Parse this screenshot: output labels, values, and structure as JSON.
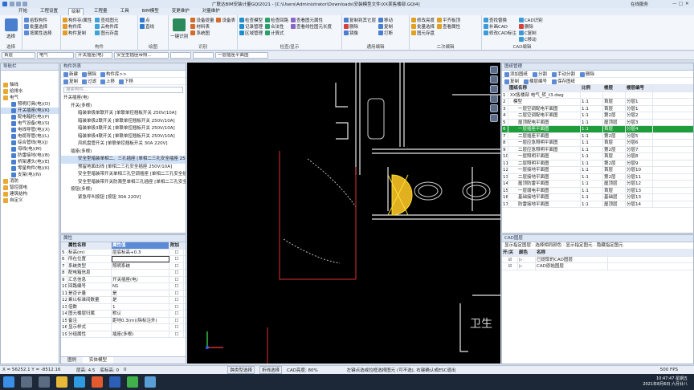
{
  "title_bar": {
    "title": "广联达BIM安装计量GQI2021 - [C:\\Users\\Administrator\\Downloads\\安装模型文件\\XX某售楼部.GQI4]",
    "right_text": "在线服务"
  },
  "menu_tabs": [
    "开始",
    "工程设置",
    "绘制",
    "工程量",
    "工具",
    "BIM模型",
    "变更维护",
    "对量维护"
  ],
  "active_tab": "绘制",
  "ribbon": {
    "select_group": {
      "big_label": "选择",
      "items": [
        "拾取构件",
        "批量选择",
        "按属性选择"
      ],
      "title": "选择"
    },
    "component_group": {
      "items": [
        "构件存/属性",
        "构件库",
        "构件复制",
        "查找图元",
        "云构件库",
        "图元存盘"
      ],
      "title": "构件"
    },
    "draw_group": {
      "items": [
        "点",
        "直线"
      ],
      "title": "绘图"
    },
    "identify_group": {
      "big_label": "一键识别",
      "items": [
        "设备提量",
        "材料表",
        "系统图",
        "设备表"
      ],
      "title": "识别"
    },
    "inspect_group": {
      "items": [
        "检查模型",
        "记录管理",
        "区域管理",
        "检查回路",
        "合法性",
        "计算式",
        "查看图元属性",
        "查看线性图元长度"
      ],
      "title": "检查/显示"
    },
    "edit_group": {
      "items": [
        "复制到其它层",
        "删除",
        "镜像",
        "移动",
        "复制",
        "打断"
      ],
      "title": "通用编辑"
    },
    "edit2_group": {
      "items": [
        "修改亮度",
        "批量选择",
        "图元存盘",
        "平齐板顶",
        "查看属性"
      ],
      "title": "二次编辑"
    },
    "cad_group": {
      "items": [
        "查找替换",
        "补画CAD",
        "修改CAD标注",
        "CAD识别",
        "删除",
        "C复制",
        "C移动"
      ],
      "title": "CAD编辑"
    }
  },
  "filter_bar": {
    "floor": "首层",
    "discipline": "电气",
    "type": "开关插座(电)",
    "component": "安全型插座带照...",
    "drawing": "一层插座平面图"
  },
  "nav_panel": {
    "title": "导航栏",
    "items": [
      {
        "label": "轴线",
        "level": 0
      },
      {
        "label": "给排水",
        "level": 0
      },
      {
        "label": "电气",
        "level": 0
      },
      {
        "label": "照明灯具(电)(D)",
        "level": 1
      },
      {
        "label": "开关插座(电)(K)",
        "level": 1,
        "selected": true
      },
      {
        "label": "配电箱柜(电)(P)",
        "level": 1
      },
      {
        "label": "电气设备(电)(S)",
        "level": 1
      },
      {
        "label": "电线导管(电)(X)",
        "level": 1
      },
      {
        "label": "电缆导管(电)(L)",
        "level": 1
      },
      {
        "label": "综合管线(电)(J)",
        "level": 1
      },
      {
        "label": "母线(电)(M)",
        "level": 1
      },
      {
        "label": "防雷接地(电)(B)",
        "level": 1
      },
      {
        "label": "桥架通头(电)(E)",
        "level": 1
      },
      {
        "label": "零星构件(电)(K)",
        "level": 1
      },
      {
        "label": "支架(电)(N)",
        "level": 1
      },
      {
        "label": "消防",
        "level": 0
      },
      {
        "label": "智控弱电",
        "level": 0
      },
      {
        "label": "建筑结构",
        "level": 0
      },
      {
        "label": "自定义",
        "level": 0
      }
    ]
  },
  "component_list": {
    "title": "构件列表",
    "toolbar": [
      "新建",
      "删除",
      "构件库>>"
    ],
    "toolbar2": [
      "复制",
      "过滤",
      "上移",
      "下移"
    ],
    "search_placeholder": "搜索构件...",
    "items": [
      {
        "label": "开关插座(电)",
        "level": 0
      },
      {
        "label": "开关(多根)",
        "level": 1
      },
      {
        "label": "暗装单极单联开关 [单联单控翘板开关 250V/10A]",
        "level": 2
      },
      {
        "label": "暗装单极2联开关 [单联单控翘板开关 250V/10A]",
        "level": 2
      },
      {
        "label": "暗装单极3联开关 [单联单控翘板开关 250V/10A]",
        "level": 2
      },
      {
        "label": "暗装单极4联开关 [单联单控翘板开关 250V/10A]",
        "level": 2
      },
      {
        "label": "风机盘管开关 [单联单控翘板开关 30A 220V]",
        "level": 2
      },
      {
        "label": "插座(多根)",
        "level": 1
      },
      {
        "label": "安全型暗装单相二、三孔插座 [单相二三孔安全插座 250V/10A]",
        "level": 2,
        "selected": true
      },
      {
        "label": "预留地面出线 [单相二三孔安全插座 250V/10A]",
        "level": 2
      },
      {
        "label": "安全型暗装带开关单相三孔空调插座 [单相二三孔安全插座]",
        "level": 2
      },
      {
        "label": "安全型暗装带开关防溅型单相三孔插座 [单相二三孔安全插]",
        "level": 2
      },
      {
        "label": "按钮(多根)",
        "level": 1
      },
      {
        "label": "紧急呼叫按钮 [按钮 30A 220V]",
        "level": 2
      }
    ]
  },
  "properties": {
    "title": "属性",
    "headers": [
      "属性名称",
      "属性值",
      "附加"
    ],
    "rows": [
      {
        "n": "5",
        "name": "标高(m)",
        "value": "层底标高+0.3"
      },
      {
        "n": "6",
        "name": "所在位置",
        "value": ""
      },
      {
        "n": "7",
        "name": "系统类型",
        "value": "照明系统"
      },
      {
        "n": "8",
        "name": "配电箱信息",
        "value": ""
      },
      {
        "n": "9",
        "name": "汇总信息",
        "value": "开关插座(电)"
      },
      {
        "n": "10",
        "name": "回路编号",
        "value": "N1"
      },
      {
        "n": "11",
        "name": "是否计量",
        "value": "是"
      },
      {
        "n": "12",
        "name": "乘以标准间数量",
        "value": "是"
      },
      {
        "n": "13",
        "name": "倍数",
        "value": "1"
      },
      {
        "n": "14",
        "name": "图元楼层归属",
        "value": "默认"
      },
      {
        "n": "15",
        "name": "备注",
        "value": "距地0.3(m)(除标注外)"
      },
      {
        "n": "16",
        "name": "显示样式",
        "value": ""
      },
      {
        "n": "19",
        "name": "分组属性",
        "value": "插座(多根)"
      }
    ],
    "bottom_tabs": [
      "图例",
      "实体模型"
    ]
  },
  "drawing_mgmt": {
    "title": "图纸管理",
    "toolbar": [
      "添加图纸",
      "分割",
      "手动分割",
      "删除"
    ],
    "toolbar2": [
      "复制",
      "楼层编号",
      "保存图纸"
    ],
    "headers": [
      "图纸名称",
      "比例",
      "楼层",
      "楼层编号"
    ],
    "rows": [
      {
        "n": "1",
        "name": "XX售楼部 电气_转_t3.dwg",
        "scale": "",
        "floor": "",
        "code": ""
      },
      {
        "n": "2",
        "name": "模型",
        "scale": "1:1",
        "floor": "首层",
        "code": "分层1"
      },
      {
        "n": "3",
        "name": "一层空调配电平面图",
        "scale": "1:1",
        "floor": "首层",
        "code": "分层1"
      },
      {
        "n": "4",
        "name": "二层空调配电平面图",
        "scale": "1:1",
        "floor": "第2层",
        "code": "分层2"
      },
      {
        "n": "5",
        "name": "屋顶配电平面图",
        "scale": "1:1",
        "floor": "屋顶层",
        "code": "分层3"
      },
      {
        "n": "6",
        "name": "一层插座平面图",
        "scale": "1:1",
        "floor": "首层",
        "code": "分层4",
        "active": true
      },
      {
        "n": "7",
        "name": "二层插座平面图",
        "scale": "1:1",
        "floor": "第2层",
        "code": "分层5"
      },
      {
        "n": "8",
        "name": "一层应急照明平面图",
        "scale": "1:1",
        "floor": "首层",
        "code": "分层6"
      },
      {
        "n": "9",
        "name": "二层应急照明平面图",
        "scale": "1:1",
        "floor": "第2层",
        "code": "分层7"
      },
      {
        "n": "10",
        "name": "一层照明平面图",
        "scale": "1:1",
        "floor": "首层",
        "code": "分层8"
      },
      {
        "n": "11",
        "name": "二层照明平面图",
        "scale": "1:1",
        "floor": "第2层",
        "code": "分层9"
      },
      {
        "n": "12",
        "name": "一层接地平面图",
        "scale": "1:1",
        "floor": "首层",
        "code": "分层10"
      },
      {
        "n": "13",
        "name": "二层接地平面图",
        "scale": "1:1",
        "floor": "第2层",
        "code": "分层11"
      },
      {
        "n": "14",
        "name": "屋顶防雷平面图",
        "scale": "1:1",
        "floor": "屋顶层",
        "code": "分层12"
      },
      {
        "n": "15",
        "name": "一层弱电平面图",
        "scale": "1:1",
        "floor": "首层",
        "code": "分层13"
      },
      {
        "n": "16",
        "name": "基础接地平面图",
        "scale": "1:1",
        "floor": "基础层",
        "code": "分层13"
      },
      {
        "n": "17",
        "name": "防雷接地平面图",
        "scale": "1:1",
        "floor": "屋顶层",
        "code": "分层14"
      }
    ]
  },
  "cad_layers": {
    "title": "CAD图层",
    "toolbar": "显示指定图层 · 选择相同颜色 · 显示指定图元 · 隐藏指定图元",
    "headers": [
      "开/关",
      "颜色",
      "名称"
    ],
    "rows": [
      "已提取的CAD图层",
      "CAD原始图层"
    ]
  },
  "canvas_text": "卫生",
  "status_bar": {
    "coords": "X = 56252.1 Y = -8512.16",
    "floor_height": "层高: 4.5",
    "base_height": "底标高: 0",
    "count": "0",
    "mode1": "跨类型选择",
    "mode2": "折线选择",
    "cad_brightness": "CAD亮度: 80%",
    "hint": "左键点选或拉框选择图元 (可不选), 右键确认或ESC退出",
    "fps": "500 FPS"
  },
  "taskbar": {
    "time": "10:47:47 星期五",
    "date": "2021年8月6日 六月廿八"
  },
  "colors": {
    "ribbon_bg": "#f3f6fb",
    "active_row": "#1f9d3a",
    "selection": "#cfe0f7",
    "canvas": "#000000"
  }
}
